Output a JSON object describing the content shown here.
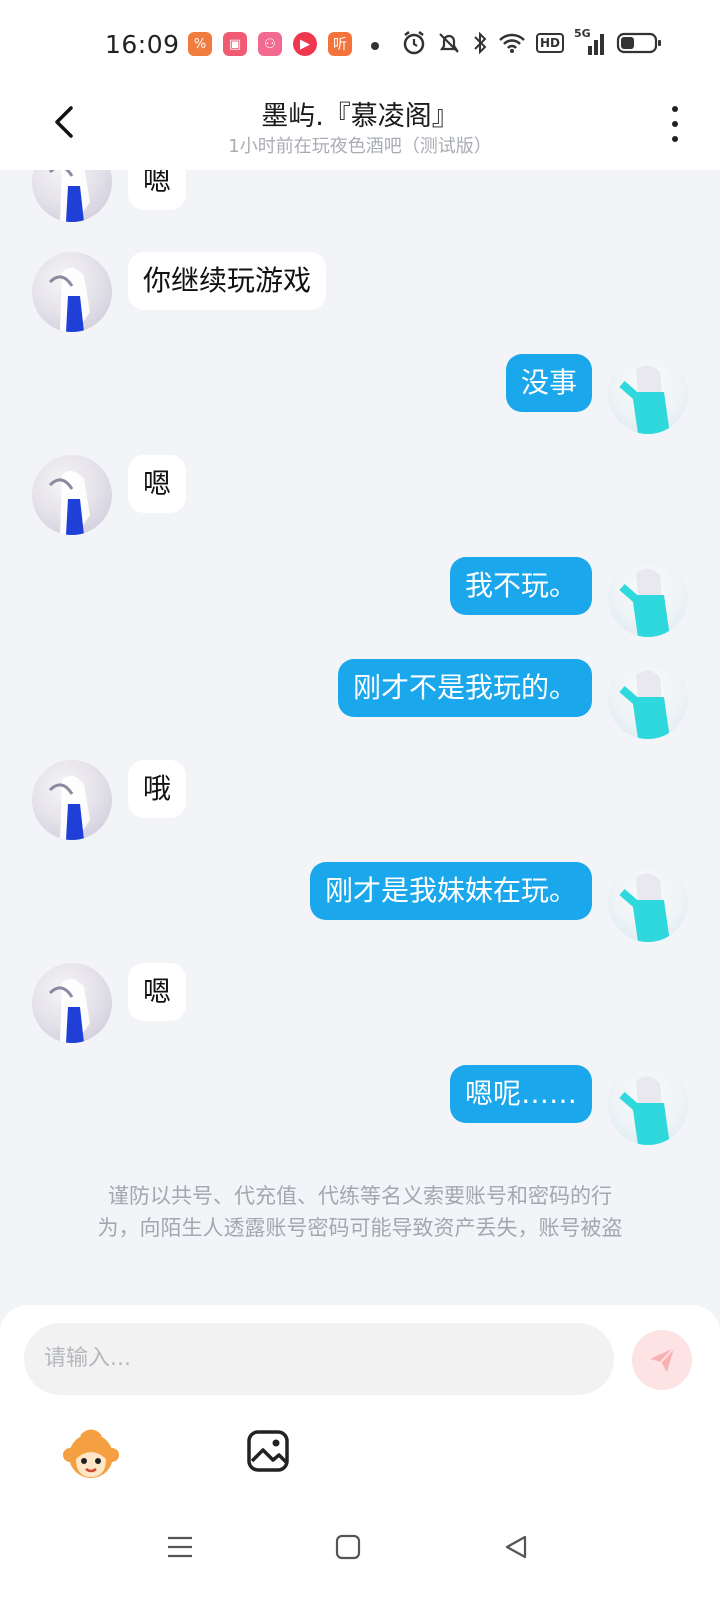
{
  "status_bar": {
    "time": "16:09",
    "app_icons": [
      {
        "name": "app-notification-icon",
        "color": "#f07c3f",
        "glyph": "%"
      },
      {
        "name": "app-video-icon",
        "color": "#f05a73",
        "glyph": "▣"
      },
      {
        "name": "app-social-icon",
        "color": "#f26a8f",
        "glyph": "⚇"
      },
      {
        "name": "app-play-icon",
        "color": "#f0374f",
        "glyph": "▶"
      },
      {
        "name": "app-listen-icon",
        "color": "#f4733c",
        "glyph": "听"
      }
    ],
    "network": "5G",
    "hd": "HD"
  },
  "header": {
    "title": "墨屿.『慕凌阁』",
    "subtitle": "1小时前在玩夜色酒吧（测试版）"
  },
  "messages": [
    {
      "from": "other",
      "text": "嗯"
    },
    {
      "from": "other",
      "text": "你继续玩游戏"
    },
    {
      "from": "me",
      "text": "没事"
    },
    {
      "from": "other",
      "text": "嗯"
    },
    {
      "from": "me",
      "text": "我不玩。"
    },
    {
      "from": "me",
      "text": "刚才不是我玩的。"
    },
    {
      "from": "other",
      "text": "哦"
    },
    {
      "from": "me",
      "text": "刚才是我妹妹在玩。"
    },
    {
      "from": "other",
      "text": "嗯"
    },
    {
      "from": "me",
      "text": "嗯呢……"
    }
  ],
  "warning": {
    "line1": "谨防以共号、代充值、代练等名义索要账号和密码的行",
    "line2": "为，向陌生人透露账号密码可能导致资产丢失，账号被盗"
  },
  "input": {
    "placeholder": "请输入..."
  },
  "colors": {
    "my_bubble": "#1aa7ec",
    "other_bubble": "#ffffff",
    "background": "#f2f4f8",
    "send_button": "#fde3e3"
  }
}
